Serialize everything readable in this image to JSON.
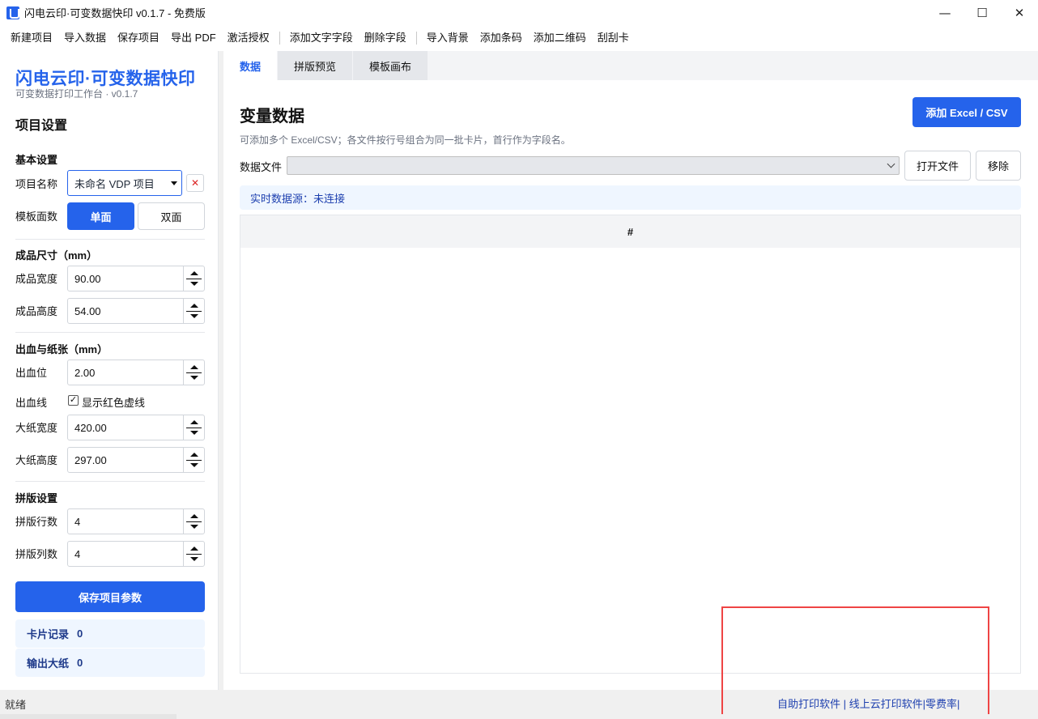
{
  "window": {
    "title": "闪电云印·可变数据快印 v0.1.7 - 免费版",
    "controls": {
      "minimize": "—",
      "maximize": "☐",
      "close": "✕"
    }
  },
  "menu": {
    "items": [
      "新建项目",
      "导入数据",
      "保存项目",
      "导出 PDF",
      "激活授权",
      "添加文字字段",
      "删除字段",
      "导入背景",
      "添加条码",
      "添加二维码",
      "刮刮卡"
    ]
  },
  "sidebar": {
    "brand_title": "闪电云印·可变数据快印",
    "brand_subtitle": "可变数据打印工作台 · v0.1.7",
    "section_title": "项目设置",
    "basic": {
      "heading": "基本设置",
      "project_name_label": "项目名称",
      "project_name_value": "未命名 VDP 项目",
      "clear_icon": "✕",
      "sides_label": "模板面数",
      "single_label": "单面",
      "double_label": "双面"
    },
    "size": {
      "heading": "成品尺寸（mm）",
      "width_label": "成品宽度",
      "width_value": "90.00",
      "height_label": "成品高度",
      "height_value": "54.00"
    },
    "bleed": {
      "heading": "出血与纸张（mm）",
      "bleed_label": "出血位",
      "bleed_value": "2.00",
      "bleed_line_label": "出血线",
      "show_red_dashed_label": "显示红色虚线",
      "show_red_dashed_checked": true,
      "sheet_width_label": "大纸宽度",
      "sheet_width_value": "420.00",
      "sheet_height_label": "大纸高度",
      "sheet_height_value": "297.00"
    },
    "imposition": {
      "heading": "拼版设置",
      "rows_label": "拼版行数",
      "rows_value": "4",
      "cols_label": "拼版列数",
      "cols_value": "4"
    },
    "save_button": "保存项目参数",
    "stats": [
      {
        "label": "卡片记录",
        "value": "0"
      },
      {
        "label": "输出大纸",
        "value": "0"
      }
    ]
  },
  "main": {
    "tabs": [
      {
        "label": "数据",
        "active": true
      },
      {
        "label": "拼版预览",
        "active": false
      },
      {
        "label": "模板画布",
        "active": false
      }
    ],
    "title": "变量数据",
    "add_button": "添加 Excel / CSV",
    "hint": "可添加多个 Excel/CSV；各文件按行号组合为同一批卡片，首行作为字段名。",
    "file_label": "数据文件",
    "file_select_value": "",
    "open_file_button": "打开文件",
    "remove_button": "移除",
    "realtime_status": "实时数据源：未连接",
    "table_header": "#"
  },
  "statusbar": {
    "text": "就绪",
    "footer_links": "自助打印软件 | 线上云打印软件|零费率|"
  },
  "colors": {
    "accent": "#2563eb",
    "info_bg": "#eff6ff",
    "highlight_box": "#ef4444"
  }
}
